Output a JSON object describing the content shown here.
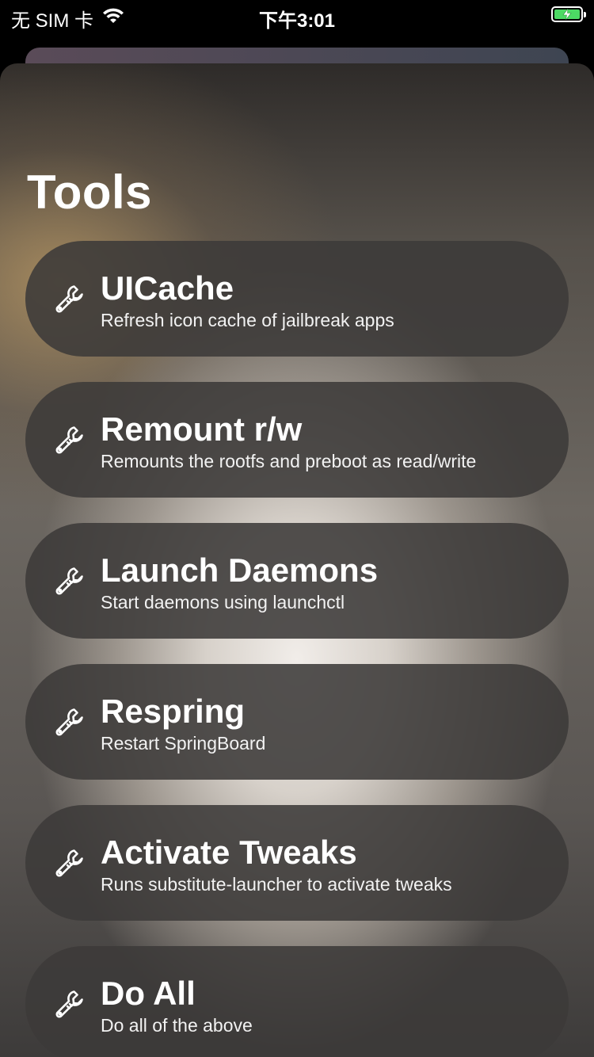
{
  "status_bar": {
    "carrier": "无 SIM 卡",
    "time": "下午3:01",
    "wifi_icon": "wifi-icon",
    "battery_icon": "battery-charging-icon",
    "battery_color": "#4cd964"
  },
  "page": {
    "title": "Tools"
  },
  "tools": [
    {
      "title": "UICache",
      "subtitle": "Refresh icon cache of jailbreak apps",
      "icon": "wrench-icon"
    },
    {
      "title": "Remount r/w",
      "subtitle": "Remounts the rootfs and preboot as read/write",
      "icon": "wrench-icon"
    },
    {
      "title": "Launch Daemons",
      "subtitle": "Start daemons using launchctl",
      "icon": "wrench-icon"
    },
    {
      "title": "Respring",
      "subtitle": "Restart SpringBoard",
      "icon": "wrench-icon"
    },
    {
      "title": "Activate Tweaks",
      "subtitle": "Runs substitute-launcher to activate tweaks",
      "icon": "wrench-icon"
    },
    {
      "title": "Do All",
      "subtitle": "Do all of the above",
      "icon": "wrench-icon"
    }
  ]
}
